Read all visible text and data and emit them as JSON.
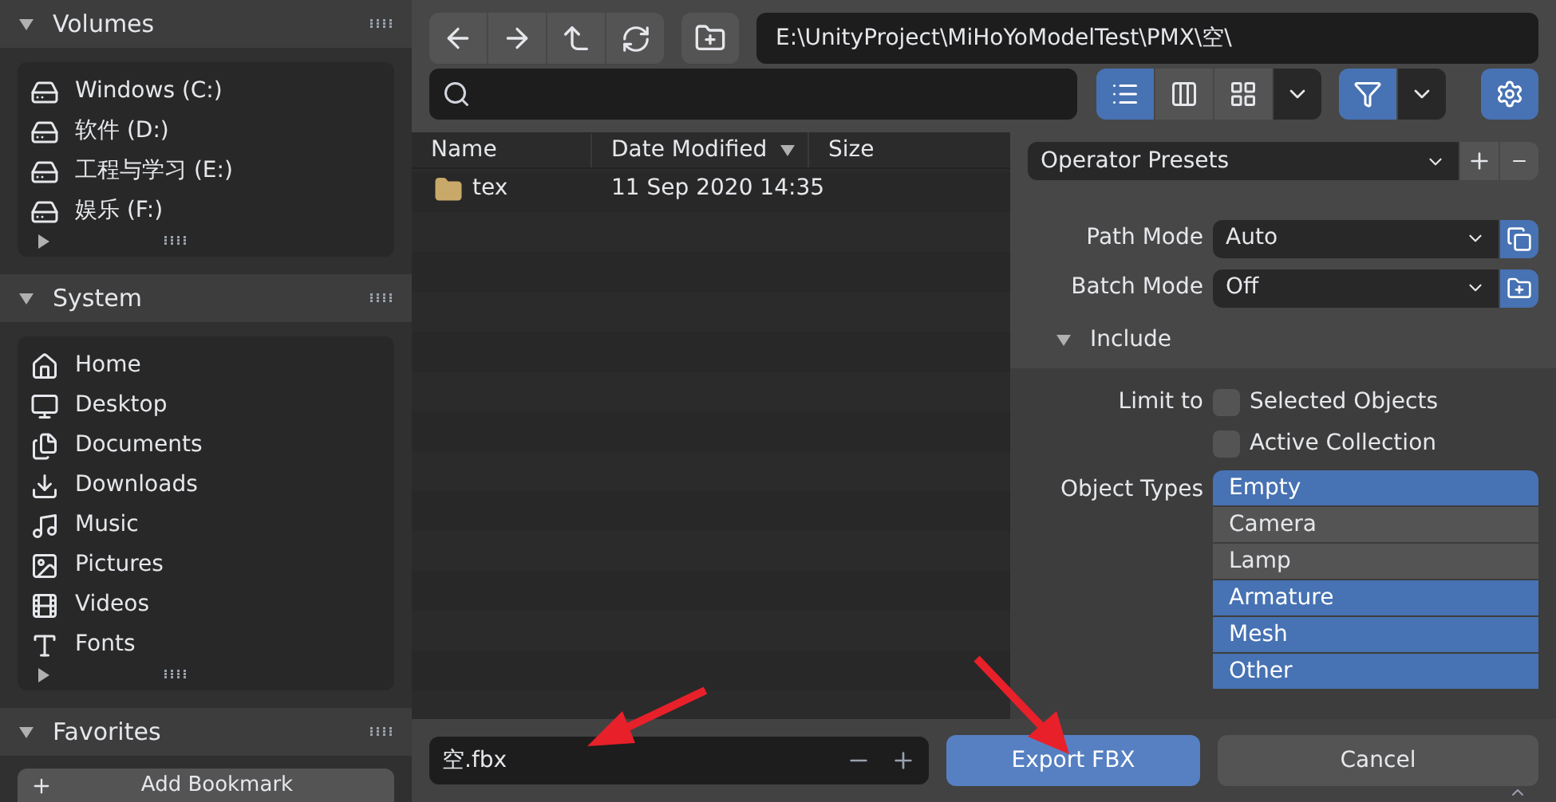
{
  "sidebar": {
    "sections": [
      {
        "title": "Volumes",
        "expanded": true,
        "kind": "list",
        "items": [
          {
            "label": "Windows (C:)",
            "kind": "drive"
          },
          {
            "label": "软件 (D:)",
            "kind": "drive"
          },
          {
            "label": "工程与学习 (E:)",
            "kind": "drive"
          },
          {
            "label": "娱乐 (F:)",
            "kind": "drive"
          }
        ]
      },
      {
        "title": "System",
        "expanded": true,
        "kind": "list",
        "items": [
          {
            "label": "Home",
            "kind": "home"
          },
          {
            "label": "Desktop",
            "kind": "desktop"
          },
          {
            "label": "Documents",
            "kind": "documents"
          },
          {
            "label": "Downloads",
            "kind": "downloads"
          },
          {
            "label": "Music",
            "kind": "music"
          },
          {
            "label": "Pictures",
            "kind": "pictures"
          },
          {
            "label": "Videos",
            "kind": "videos"
          },
          {
            "label": "Fonts",
            "kind": "fonts"
          }
        ]
      },
      {
        "title": "Favorites",
        "expanded": true,
        "kind": "button",
        "button": "Add Bookmark"
      }
    ]
  },
  "toolbar": {
    "path": "E:\\UnityProject\\MiHoYoModelTest\\PMX\\空\\",
    "view_modes": [
      {
        "kind": "vertical-list",
        "selected": true
      },
      {
        "kind": "horizontal-list",
        "selected": false
      },
      {
        "kind": "thumbnails",
        "selected": false
      }
    ],
    "filter_on": true
  },
  "file_list": {
    "columns": [
      "Name",
      "Date Modified",
      "Size"
    ],
    "rows": [
      {
        "name": "tex",
        "date": "11 Sep 2020 14:35"
      }
    ]
  },
  "options": {
    "presets": "Operator Presets",
    "fields": [
      {
        "label": "Path Mode",
        "value": "Auto",
        "kind": "copy"
      },
      {
        "label": "Batch Mode",
        "value": "Off",
        "kind": "folder"
      }
    ],
    "include": {
      "title": "Include",
      "expanded": true,
      "limit_label": "Limit to",
      "limits": [
        {
          "label": "Selected Objects",
          "checked": false
        },
        {
          "label": "Active Collection",
          "checked": false
        }
      ],
      "types_label": "Object Types",
      "types": [
        {
          "label": "Empty",
          "selected": true
        },
        {
          "label": "Camera",
          "selected": false
        },
        {
          "label": "Lamp",
          "selected": false
        },
        {
          "label": "Armature",
          "selected": true
        },
        {
          "label": "Mesh",
          "selected": true
        },
        {
          "label": "Other",
          "selected": true
        }
      ]
    }
  },
  "bottom": {
    "filename": "空.fbx",
    "confirm": "Export FBX",
    "cancel": "Cancel"
  }
}
